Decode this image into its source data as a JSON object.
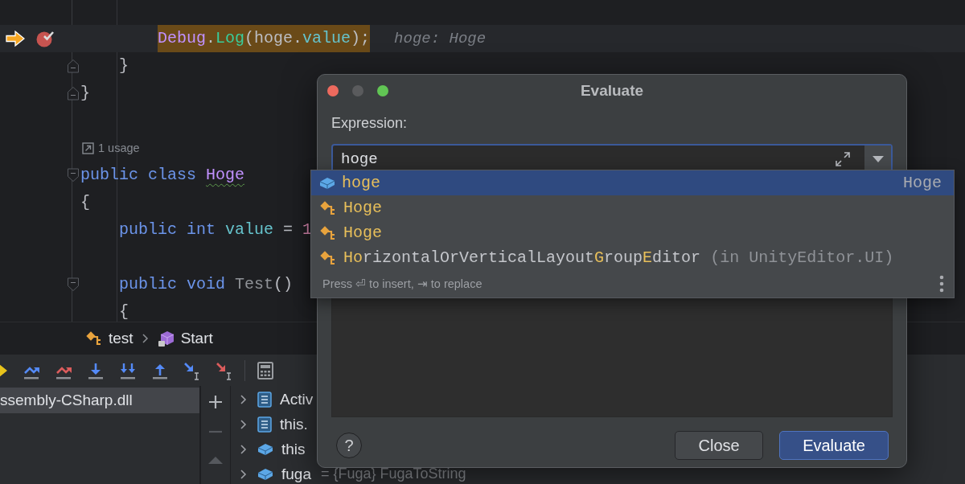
{
  "editor": {
    "lines": [
      {
        "kind": "code",
        "execution_point": true,
        "breakpoint": true,
        "tokens": [
          {
            "text": "        Debug",
            "kind": "class"
          },
          {
            "text": ".",
            "kind": "plain"
          },
          {
            "text": "Log",
            "kind": "method"
          },
          {
            "text": "(hoge.",
            "kind": "plain"
          },
          {
            "text": "value",
            "kind": "field"
          },
          {
            "text": ");",
            "kind": "plain"
          }
        ],
        "inline_hint": "hoge: Hoge"
      },
      {
        "kind": "code",
        "fold_end": true,
        "tokens": [
          {
            "text": "    }",
            "kind": "plain"
          }
        ]
      },
      {
        "kind": "code",
        "fold_end": true,
        "tokens": [
          {
            "text": "}",
            "kind": "plain"
          }
        ]
      },
      {
        "kind": "blank"
      },
      {
        "kind": "usage",
        "text": "1 usage"
      },
      {
        "kind": "code",
        "fold_start": true,
        "tokens": [
          {
            "text": "public class ",
            "kind": "keyword"
          },
          {
            "text": "Hoge",
            "kind": "class",
            "warning": true
          }
        ]
      },
      {
        "kind": "code",
        "tokens": [
          {
            "text": "{",
            "kind": "plain"
          }
        ]
      },
      {
        "kind": "code",
        "tokens": [
          {
            "text": "    public int ",
            "kind": "keyword"
          },
          {
            "text": "value",
            "kind": "field"
          },
          {
            "text": " = ",
            "kind": "plain"
          },
          {
            "text": "1",
            "kind": "number"
          }
        ]
      },
      {
        "kind": "blank"
      },
      {
        "kind": "code",
        "fold_start": true,
        "tokens": [
          {
            "text": "    public void ",
            "kind": "keyword"
          },
          {
            "text": "Test",
            "kind": "unused"
          },
          {
            "text": "()",
            "kind": "plain"
          }
        ]
      },
      {
        "kind": "code",
        "tokens": [
          {
            "text": "    {",
            "kind": "plain"
          }
        ]
      }
    ]
  },
  "breadcrumbs": [
    {
      "text": "test",
      "kind": "method"
    },
    {
      "text": "Start",
      "kind": "locked"
    }
  ],
  "frames": [
    {
      "text": "ssembly-CSharp.dll",
      "selected": true
    }
  ],
  "variable_actions": [
    {
      "kind": "add",
      "disabled": false
    },
    {
      "kind": "remove",
      "disabled": true
    },
    {
      "kind": "move_up",
      "disabled": true
    }
  ],
  "variables": [
    {
      "name": "Activ",
      "kind": "list",
      "expanded": false
    },
    {
      "name": "this.",
      "kind": "list",
      "expanded": false
    },
    {
      "name": "this",
      "kind": "field",
      "expanded": false
    },
    {
      "name": "fuga",
      "kind": "field",
      "expanded": false,
      "detail": "= {Fuga} FugaToString"
    }
  ],
  "dialog": {
    "title": "Evaluate",
    "window_buttons": [
      {
        "kind": "close",
        "disabled": false
      },
      {
        "kind": "minimize",
        "disabled": true
      },
      {
        "kind": "zoom",
        "disabled": false
      }
    ],
    "expression_label": "Expression:",
    "expression": "hoge",
    "completion": {
      "items": [
        {
          "kind": "field",
          "selected": true,
          "segments": [
            {
              "text": "hoge",
              "matched": true
            }
          ],
          "type": "Hoge"
        },
        {
          "kind": "class",
          "selected": false,
          "segments": [
            {
              "text": "Hoge",
              "matched": true
            }
          ]
        },
        {
          "kind": "class",
          "selected": false,
          "segments": [
            {
              "text": "Hoge",
              "matched": true
            }
          ]
        },
        {
          "kind": "class",
          "selected": false,
          "segments": [
            {
              "text": "Ho",
              "matched": true
            },
            {
              "text": "rizontalOrVerticalLayout",
              "matched": false
            },
            {
              "text": "G",
              "matched": true
            },
            {
              "text": "roup",
              "matched": false
            },
            {
              "text": "E",
              "matched": true
            },
            {
              "text": "ditor",
              "matched": false
            }
          ],
          "location": "(in UnityEditor.UI)"
        }
      ],
      "hint": "Press ⏎ to insert, ⇥ to replace"
    },
    "help": "?",
    "buttons": [
      {
        "label": "Close",
        "default": false
      },
      {
        "label": "Evaluate",
        "default": true
      }
    ]
  }
}
